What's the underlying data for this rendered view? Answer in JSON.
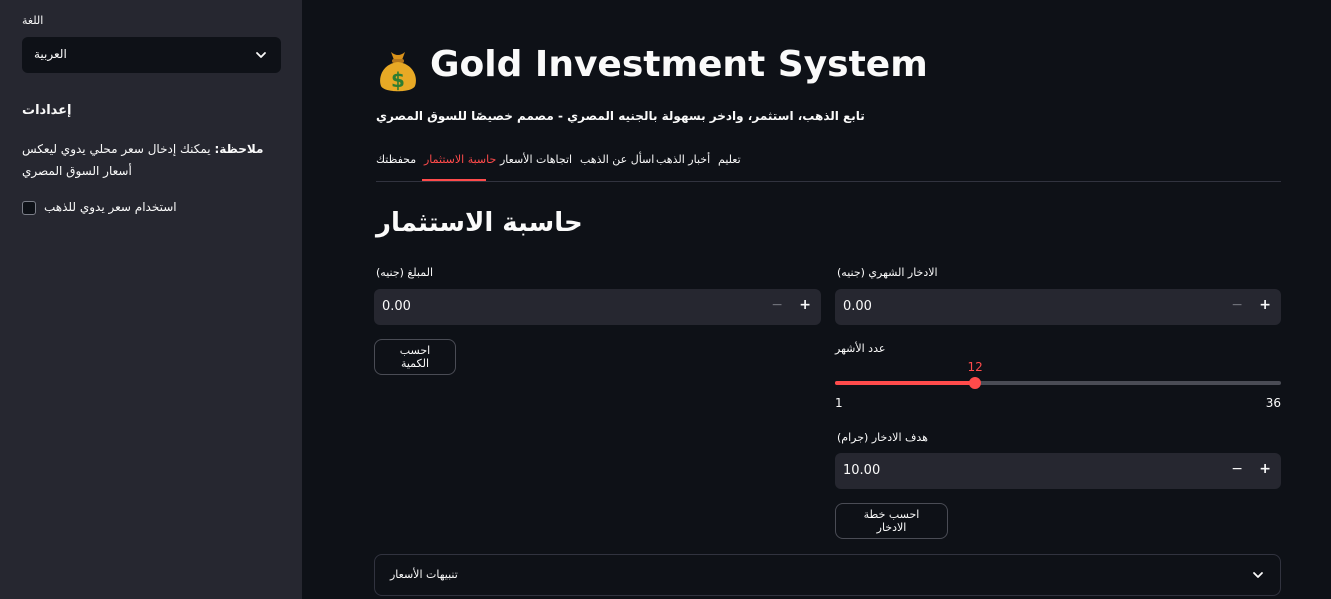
{
  "sidebar": {
    "language_label": "اللغة",
    "language_select": {
      "selected": "العربية"
    },
    "settings_heading": "إعدادات",
    "note_bold": "ملاحظة:",
    "note_text": " يمكنك إدخال سعر محلي يدوي ليعكس أسعار السوق المصري",
    "manual_price_checkbox": {
      "label": "استخدام سعر يدوي للذهب",
      "checked": false
    }
  },
  "header": {
    "emoji": "moneybag-icon",
    "title": "Gold Investment System",
    "subtitle": "تابع الذهب، استثمر، وادخر بسهولة بالجنيه المصري - مصمم خصيصًا للسوق المصري"
  },
  "tabs": [
    {
      "label": "محفظتك",
      "active": false
    },
    {
      "label": "حاسبة الاستثمار",
      "active": true
    },
    {
      "label": "اتجاهات الأسعار",
      "active": false
    },
    {
      "label": "اسأل عن الذهب",
      "active": false
    },
    {
      "label": "أخبار الذهب",
      "active": false
    },
    {
      "label": "تعليم",
      "active": false
    }
  ],
  "calculator": {
    "heading": "حاسبة الاستثمار",
    "amount": {
      "label": "المبلغ (جنيه)",
      "value": "0.00"
    },
    "calc_quantity_button": "احسب الكمية",
    "monthly_saving": {
      "label": "الادخار الشهري (جنيه)",
      "value": "0.00"
    },
    "months_slider": {
      "label": "عدد الأشهر",
      "value": 12,
      "min": 1,
      "max": 36,
      "value_text": "12",
      "min_text": "1",
      "max_text": "36"
    },
    "saving_goal": {
      "label": "هدف الادخار (جرام)",
      "value": "10.00"
    },
    "calc_plan_button": "احسب خطة الادخار"
  },
  "alerts_expander": {
    "label": "تنبيهات الأسعار"
  },
  "colors": {
    "accent": "#ff4b4b",
    "background": "#0e1117",
    "sidebar": "#262730",
    "gold": "#e8a925"
  }
}
